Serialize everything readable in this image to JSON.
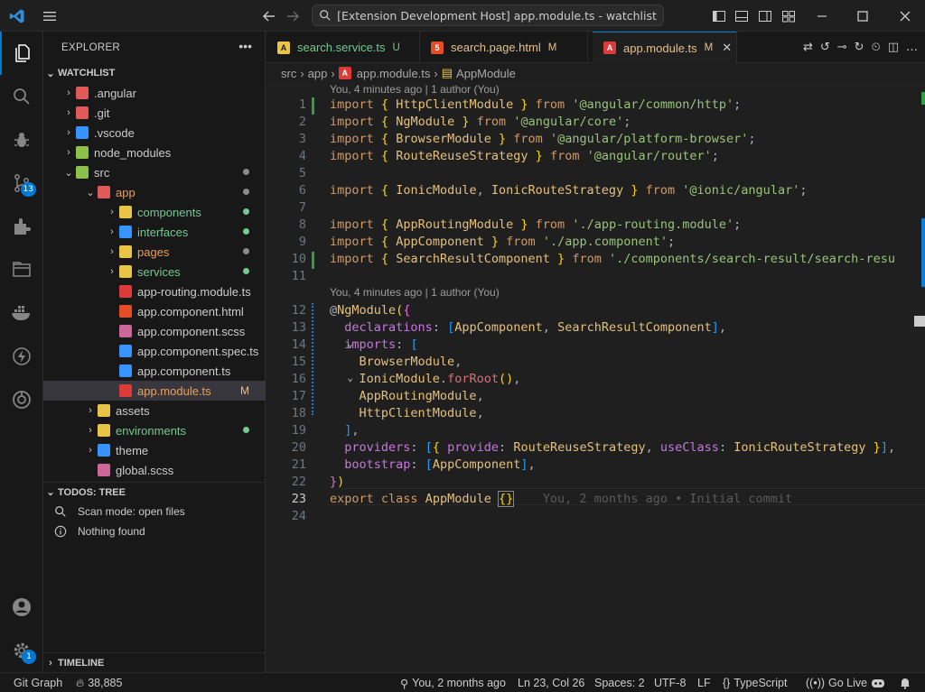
{
  "titlebar": {
    "search_text": "[Extension Development Host] app.module.ts - watchlist"
  },
  "activity": {
    "source_control_badge": "13",
    "settings_badge": "1"
  },
  "explorer": {
    "header": "EXPLORER",
    "more": "•••",
    "root": "WATCHLIST",
    "items": [
      {
        "label": ".angular",
        "color": "#cccccc"
      },
      {
        "label": ".git",
        "color": "#cccccc"
      },
      {
        "label": ".vscode",
        "color": "#cccccc"
      },
      {
        "label": "node_modules",
        "color": "#cccccc"
      },
      {
        "label": "src",
        "color": "#cccccc"
      },
      {
        "label": "app",
        "color": "#e8a05c"
      },
      {
        "label": "components",
        "color": "#73c991"
      },
      {
        "label": "interfaces",
        "color": "#73c991"
      },
      {
        "label": "pages",
        "color": "#e8a05c"
      },
      {
        "label": "services",
        "color": "#73c991"
      },
      {
        "label": "app-routing.module.ts",
        "color": "#cccccc"
      },
      {
        "label": "app.component.html",
        "color": "#cccccc"
      },
      {
        "label": "app.component.scss",
        "color": "#cccccc"
      },
      {
        "label": "app.component.spec.ts",
        "color": "#cccccc"
      },
      {
        "label": "app.component.ts",
        "color": "#cccccc"
      },
      {
        "label": "app.module.ts",
        "color": "#e8a05c"
      },
      {
        "label": "assets",
        "color": "#cccccc"
      },
      {
        "label": "environments",
        "color": "#73c991"
      },
      {
        "label": "theme",
        "color": "#cccccc"
      },
      {
        "label": "global.scss",
        "color": "#cccccc"
      }
    ],
    "modified_marker": "M"
  },
  "todos": {
    "header": "TODOS: TREE",
    "scan_mode": "Scan mode: open files",
    "nothing": "Nothing found"
  },
  "timeline": {
    "header": "TIMELINE"
  },
  "tabs": [
    {
      "label": "search.service.ts",
      "status": "U",
      "status_color": "#73c991",
      "label_color": "#73c991"
    },
    {
      "label": "search.page.html",
      "status": "M",
      "status_color": "#e2c08d",
      "label_color": "#e2c08d"
    },
    {
      "label": "app.module.ts",
      "status": "M",
      "status_color": "#e2c08d",
      "label_color": "#e2c08d"
    }
  ],
  "breadcrumb": {
    "parts": [
      "src",
      "app",
      "app.module.ts",
      "AppModule"
    ]
  },
  "editor": {
    "codelens_1": "You, 4 minutes ago | 1 author (You)",
    "codelens_2": "You, 4 minutes ago | 1 author (You)",
    "blame": "You, 2 months ago • Initial commit",
    "line_numbers": [
      "1",
      "2",
      "3",
      "4",
      "5",
      "6",
      "7",
      "8",
      "9",
      "10",
      "11",
      "12",
      "13",
      "14",
      "15",
      "16",
      "17",
      "18",
      "19",
      "20",
      "21",
      "22",
      "23",
      "24"
    ]
  },
  "statusbar": {
    "git_graph": "Git Graph",
    "fire_count": "38,885",
    "blame": "You, 2 months ago",
    "position": "Ln 23, Col 26",
    "spaces": "Spaces: 2",
    "encoding": "UTF-8",
    "eol": "LF",
    "language": "TypeScript",
    "go_live": "Go Live"
  }
}
